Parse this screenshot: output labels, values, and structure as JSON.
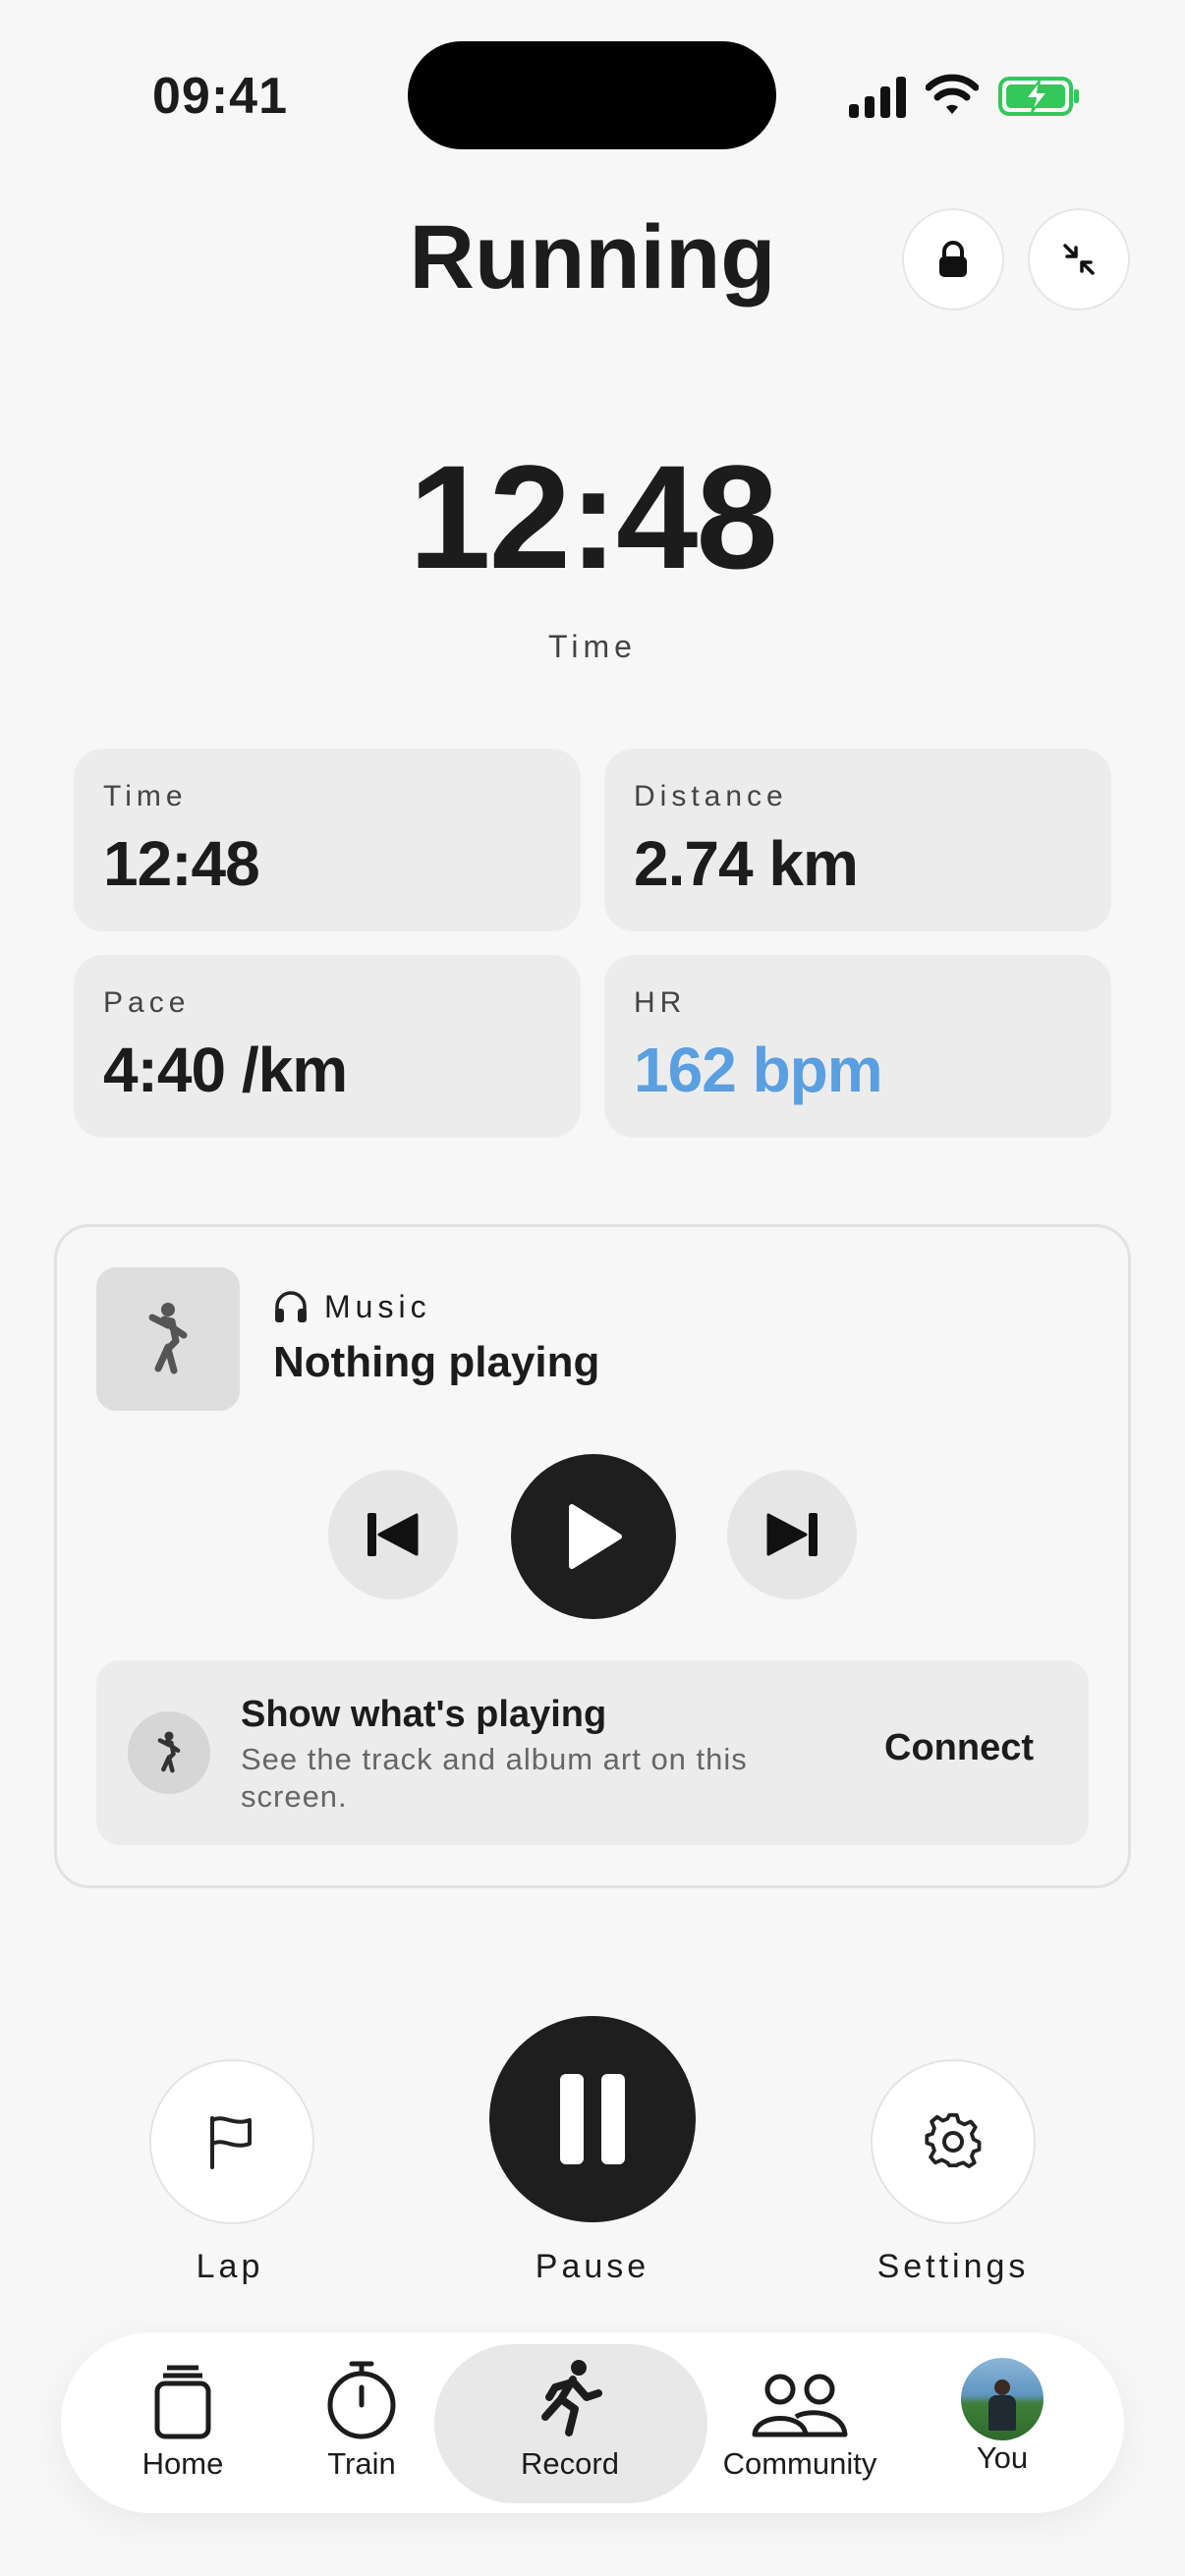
{
  "status": {
    "time": "09:41"
  },
  "header": {
    "title": "Running"
  },
  "timer": {
    "value": "12:48",
    "label": "Time"
  },
  "stats": [
    {
      "label": "Time",
      "value": "12:48"
    },
    {
      "label": "Distance",
      "value": "2.74 km"
    },
    {
      "label": "Pace",
      "value": "4:40 /km"
    },
    {
      "label": "HR",
      "value": "162 bpm"
    }
  ],
  "colors": {
    "hr": "#5a9fe0",
    "battery": "#34c759"
  },
  "music": {
    "label": "Music",
    "now_playing": "Nothing playing",
    "connect_title": "Show what's playing",
    "connect_subtitle": "See the track and album art on this screen.",
    "connect_button": "Connect"
  },
  "actions": {
    "lap": "Lap",
    "pause": "Pause",
    "settings": "Settings"
  },
  "tabs": [
    {
      "label": "Home",
      "icon": "home-icon"
    },
    {
      "label": "Train",
      "icon": "stopwatch-icon"
    },
    {
      "label": "Record",
      "icon": "runner-icon",
      "active": true
    },
    {
      "label": "Community",
      "icon": "people-icon"
    },
    {
      "label": "You",
      "icon": "avatar"
    }
  ]
}
